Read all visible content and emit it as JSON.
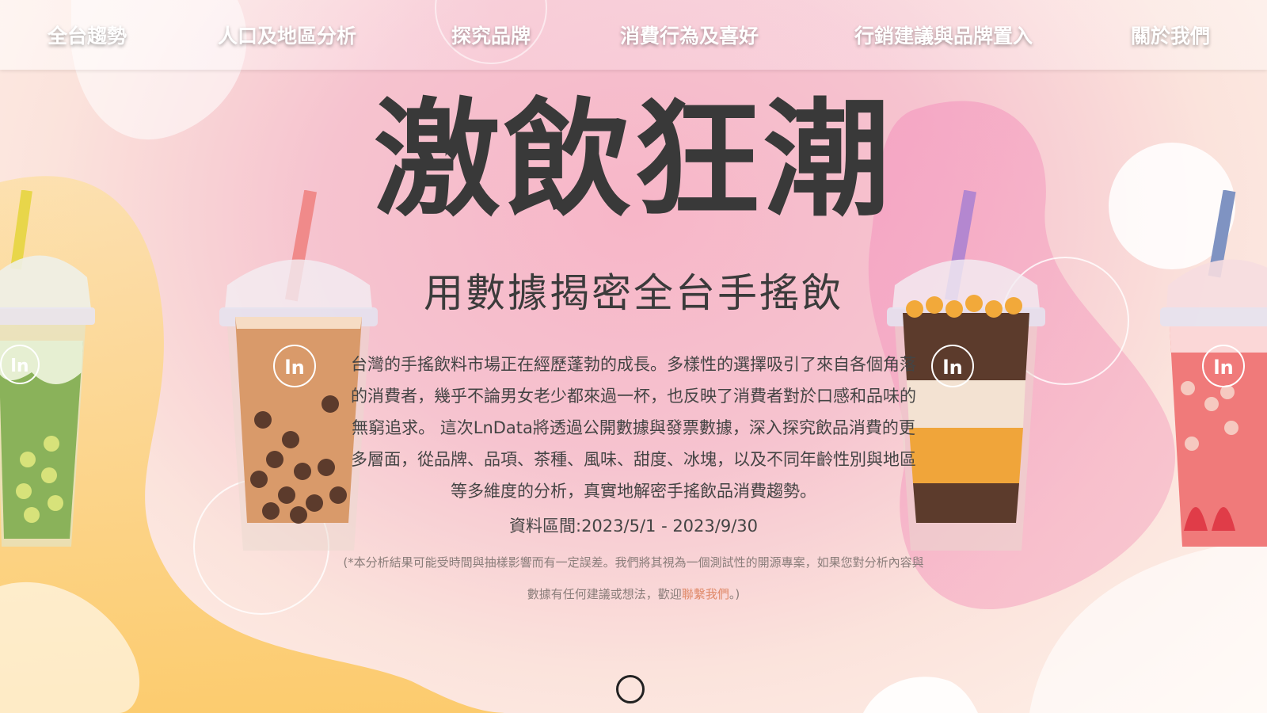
{
  "nav": {
    "items": [
      {
        "label": "全台趨勢"
      },
      {
        "label": "人口及地區分析"
      },
      {
        "label": "探究品牌"
      },
      {
        "label": "消費行為及喜好"
      },
      {
        "label": "行銷建議與品牌置入"
      },
      {
        "label": "關於我們"
      }
    ]
  },
  "hero": {
    "title": "激飲狂潮",
    "subtitle": "用數據揭密全台手搖飲",
    "description": "台灣的手搖飲料市場正在經歷蓬勃的成長。多樣性的選擇吸引了來自各個角落的消費者，幾乎不論男女老少都來過一杯，也反映了消費者對於口感和品味的無窮追求。 這次LnData將透過公開數據與發票數據，深入探究飲品消費的更多層面，從品牌、品項、茶種、風味、甜度、冰塊，以及不同年齡性別與地區等多維度的分析，真實地解密手搖飲品消費趨勢。",
    "period": "資料區間:2023/5/1 - 2023/9/30",
    "note_before": "(*本分析結果可能受時間與抽樣影響而有一定誤差。我們將其視為一個測試性的開源專案，如果您對分析內容與數據有任何建議或想法，歡迎",
    "note_link": "聯繫我們",
    "note_after": "。)"
  },
  "colors": {
    "accent_link": "#e08a6a",
    "title_text": "#393939",
    "bg_pink": "#f7b6c8",
    "bg_yellow": "#fcd37a"
  },
  "icons": {
    "cup_logo": "ln-logo-icon",
    "scroll": "scroll-down-icon"
  }
}
